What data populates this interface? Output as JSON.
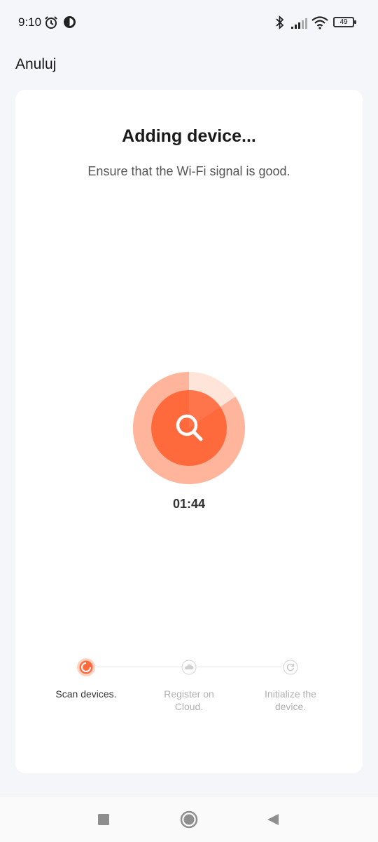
{
  "status_bar": {
    "time": "9:10",
    "battery": "49",
    "icons": [
      "alarm-icon",
      "circle-app-icon",
      "bluetooth-icon",
      "signal-icon",
      "wifi-icon",
      "battery-icon"
    ]
  },
  "header": {
    "cancel_label": "Anuluj"
  },
  "main": {
    "title": "Adding device...",
    "subtitle": "Ensure that the Wi-Fi signal is good.",
    "timer": "01:44",
    "accent_color": "#ff6a3d"
  },
  "steps": [
    {
      "label": "Scan devices.",
      "icon": "scan-active-icon",
      "active": true
    },
    {
      "label": "Register on Cloud.",
      "icon": "cloud-icon",
      "active": false
    },
    {
      "label": "Initialize the device.",
      "icon": "refresh-icon",
      "active": false
    }
  ],
  "nav": {
    "buttons": [
      "recents-square-icon",
      "home-circle-icon",
      "back-triangle-icon"
    ]
  }
}
